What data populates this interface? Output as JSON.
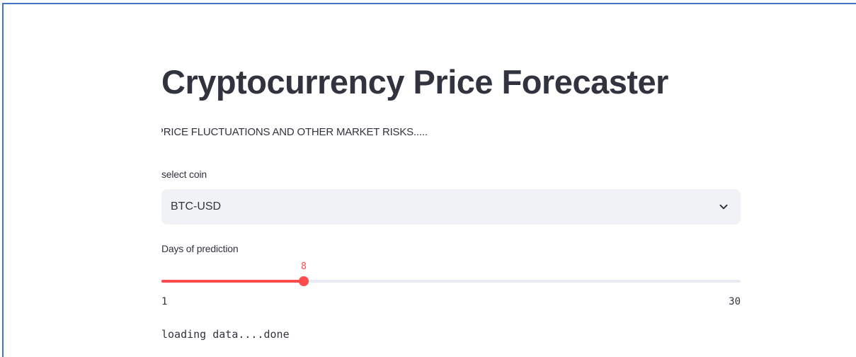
{
  "app": {
    "title": "Cryptocurrency Price Forecaster",
    "marquee_text": "PRICE FLUCTUATIONS AND OTHER MARKET RISKS....."
  },
  "coin_select": {
    "label": "select coin",
    "selected_value": "BTC-USD",
    "icon": "chevron-down-icon"
  },
  "prediction_slider": {
    "label": "Days of prediction",
    "value": 8,
    "min": 1,
    "max": 30,
    "accent_color": "#ff4b4b",
    "track_color": "#e6eaf1"
  },
  "status": {
    "text": "loading data....done"
  }
}
